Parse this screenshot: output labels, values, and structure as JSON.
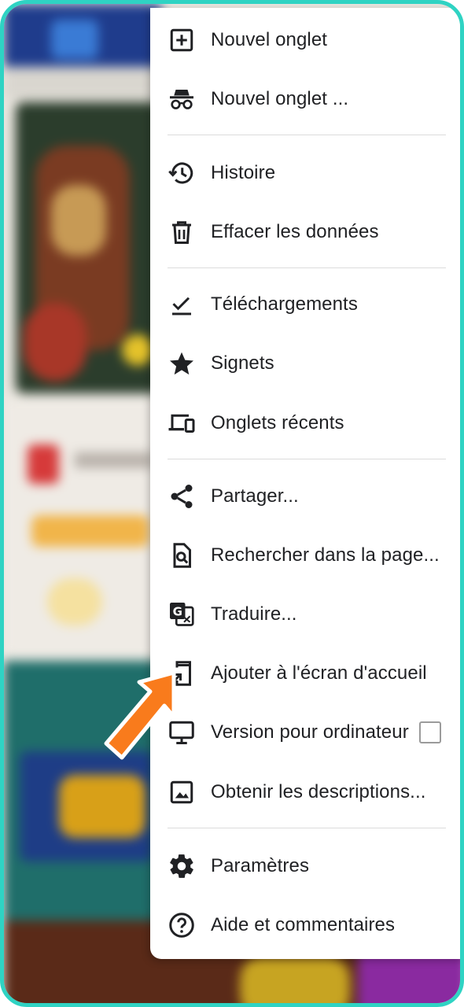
{
  "menu": {
    "items": [
      {
        "label": "Nouvel onglet",
        "icon": "plus-box-icon"
      },
      {
        "label": "Nouvel onglet ...",
        "icon": "incognito-icon"
      },
      {
        "label": "Histoire",
        "icon": "history-icon"
      },
      {
        "label": "Effacer les données",
        "icon": "trash-icon"
      },
      {
        "label": "Téléchargements",
        "icon": "download-check-icon"
      },
      {
        "label": "Signets",
        "icon": "star-icon"
      },
      {
        "label": "Onglets récents",
        "icon": "devices-icon"
      },
      {
        "label": "Partager...",
        "icon": "share-icon"
      },
      {
        "label": "Rechercher dans la page...",
        "icon": "find-in-page-icon"
      },
      {
        "label": "Traduire...",
        "icon": "translate-icon"
      },
      {
        "label": "Ajouter à l'écran d'accueil",
        "icon": "add-to-home-icon"
      },
      {
        "label": "Version pour ordinateur",
        "icon": "desktop-icon",
        "checked": false
      },
      {
        "label": "Obtenir les descriptions...",
        "icon": "image-icon"
      },
      {
        "label": "Paramètres",
        "icon": "gear-icon"
      },
      {
        "label": "Aide et commentaires",
        "icon": "help-icon"
      }
    ]
  },
  "colors": {
    "frame_border": "#2fd3c3",
    "pointer_arrow": "#f97b1c",
    "menu_text": "#202124"
  }
}
